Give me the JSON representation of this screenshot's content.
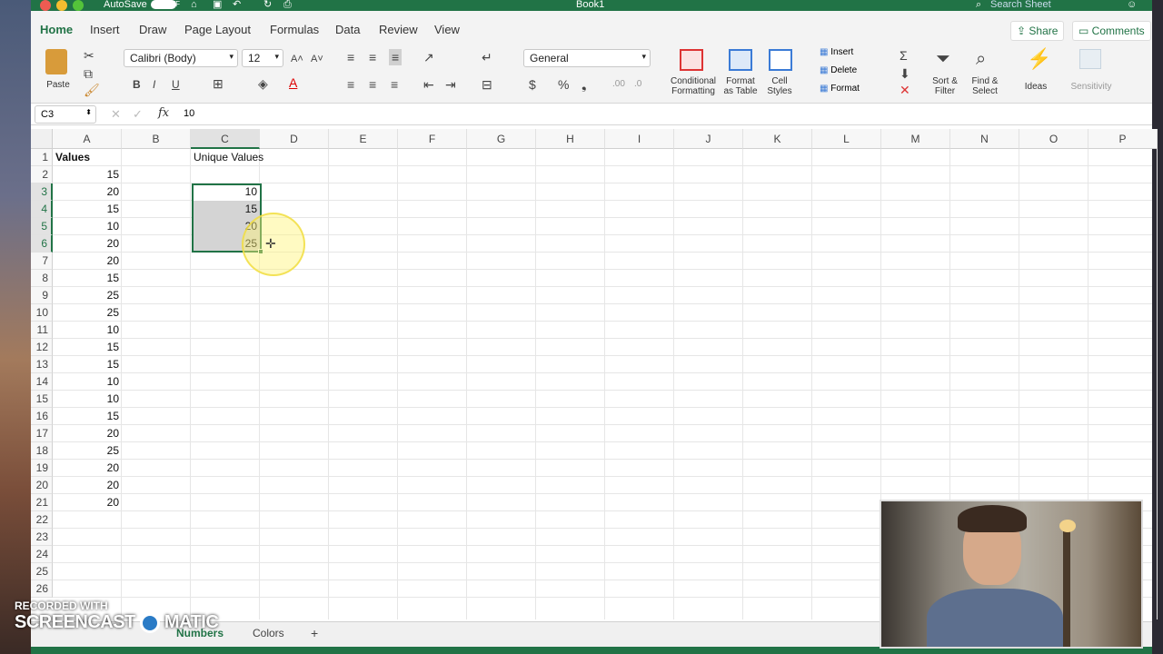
{
  "titlebar": {
    "autosave_label": "AutoSave",
    "autosave_state": "OFF",
    "doc_title": "Book1",
    "search_placeholder": "Search Sheet"
  },
  "tabs": [
    "Home",
    "Insert",
    "Draw",
    "Page Layout",
    "Formulas",
    "Data",
    "Review",
    "View"
  ],
  "share_label": "Share",
  "comments_label": "Comments",
  "ribbon": {
    "paste": "Paste",
    "font_name": "Calibri (Body)",
    "font_size": "12",
    "number_format": "General",
    "conditional_formatting": [
      "Conditional",
      "Formatting"
    ],
    "format_as_table": [
      "Format",
      "as Table"
    ],
    "cell_styles": [
      "Cell",
      "Styles"
    ],
    "insert": "Insert",
    "delete": "Delete",
    "format": "Format",
    "sort_filter": [
      "Sort &",
      "Filter"
    ],
    "find_select": [
      "Find &",
      "Select"
    ],
    "ideas": "Ideas",
    "sensitivity": "Sensitivity"
  },
  "formula": {
    "name_box": "C3",
    "fx": "fx",
    "content": "10"
  },
  "columns": [
    "A",
    "B",
    "C",
    "D",
    "E",
    "F",
    "G",
    "H",
    "I",
    "J",
    "K",
    "L",
    "M",
    "N",
    "O",
    "P"
  ],
  "rows": [
    "1",
    "2",
    "3",
    "4",
    "5",
    "6",
    "7",
    "8",
    "9",
    "10",
    "11",
    "12",
    "13",
    "14",
    "15",
    "16",
    "17",
    "18",
    "19",
    "20",
    "21",
    "22",
    "23",
    "24",
    "25",
    "26"
  ],
  "headers": {
    "a1": "Values",
    "c1": "Unique Values"
  },
  "col_a_values": [
    "15",
    "20",
    "15",
    "10",
    "20",
    "20",
    "15",
    "25",
    "25",
    "10",
    "15",
    "15",
    "10",
    "10",
    "15",
    "20",
    "25",
    "20",
    "20",
    "20"
  ],
  "col_c_values": [
    "10",
    "15",
    "20",
    "25"
  ],
  "sheets": [
    "Numbers",
    "Colors"
  ],
  "add_sheet": "+",
  "watermark": {
    "line1": "RECORDED WITH",
    "line2": "SCREENCAST",
    "line3": "MATIC"
  },
  "colors": {
    "accent": "#217346",
    "selection": "#d4d4d4"
  }
}
